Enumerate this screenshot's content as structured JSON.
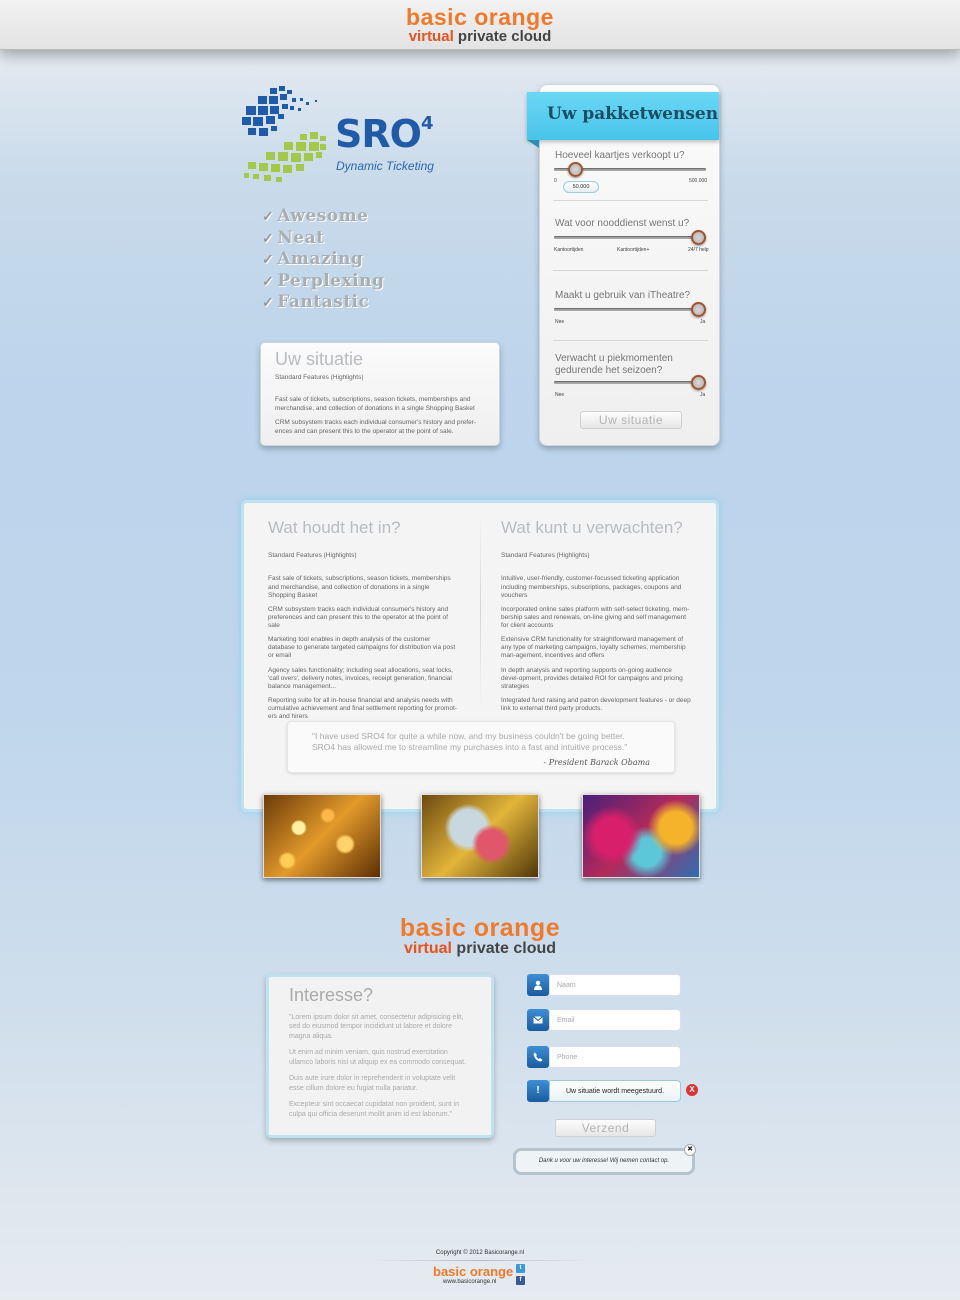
{
  "header": {
    "logo_line1": "basic orange",
    "logo_virtual": "virtual",
    "logo_rest": " private cloud"
  },
  "product": {
    "name": "SRO",
    "superscript": "4",
    "tagline": "Dynamic Ticketing"
  },
  "features": [
    "Awesome",
    "Neat",
    "Amazing",
    "Perplexing",
    "Fantastic"
  ],
  "situation_card": {
    "title": "Uw situatie",
    "subtitle": "Standard Features  (Highlights)",
    "para1": "Fast sale of tickets, subscriptions, season tickets, memberships and merchandise, and collection of donations in a single Shopping Basket",
    "para2": "CRM subsystem tracks each individual consumer's history and prefer-ences and can present this to the operator at the point of sale."
  },
  "package": {
    "title": "Uw pakketwensen",
    "q1": "Hoeveel kaartjes verkoopt u?",
    "q1_min": "0",
    "q1_max": "500.000",
    "q1_value": "50.000",
    "q1_level": 0.1,
    "q2": "Wat voor nooddienst wenst u?",
    "q2_opt1": "Kantoortijden",
    "q2_opt2": "Kantoortijden+",
    "q2_opt3": "24/7 help",
    "q2_level": 1.0,
    "q3": "Maakt u gebruik van iTheatre?",
    "q3_min": "Nee",
    "q3_max": "Ja",
    "q3_level": 1.0,
    "q4": "Verwacht u piekmomenten gedurende het seizoen?",
    "q4_min": "Nee",
    "q4_max": "Ja",
    "q4_level": 1.0,
    "button": "Uw situatie"
  },
  "info": {
    "left_title": "Wat houdt het in?",
    "left_sub": "Standard Features  (Highlights)",
    "left_paras": [
      "Fast sale of tickets, subscriptions, season tickets, memberships and merchandise, and collection of donations in a single Shopping Basket",
      "CRM subsystem tracks each individual consumer's history and preferences and can present this to the operator at the point of sale",
      "Marketing tool enables in depth analysis of the customer database to generate targeted campaigns for distribution via post or email",
      "Agency sales functionality; including seat allocations, seat locks, 'call overs', delivery notes, invoices, receipt generation, financial balance management...",
      "Reporting suite for all in-house financial and analysis needs with cumulative achievement and final settlement reporting for promot-ers and hirers"
    ],
    "right_title": "Wat kunt u verwachten?",
    "right_sub": "Standard Features (Highlights)",
    "right_paras": [
      "Intuitive, user-friendly, customer-focussed ticketing application including memberships, subscriptions, packages, coupons and vouchers",
      "Incorporated online sales platform with self-select ticketing, mem-bership sales and renewals, on-line giving and self management for client accounts",
      "Extensive CRM functionality for straightforward management of any type of marketing campaigns, loyalty schemes, membership man-agement, incentives and offers",
      "In depth analysis and reporting supports on-going audience devel-opment, provides detailed ROI for campaigns and pricing strategies",
      "Integrated fund raising and patron development features - or deep link to external third party products."
    ],
    "quote_line1": "\"I have used SRO4 for quite a while now, and my business couldn't be going better.",
    "quote_line2": "SRO4 has allowed me to streamline my purchases into a fast and intuitive process.\"",
    "quote_author": "- President Barack Obama"
  },
  "interest": {
    "title": "Interesse?",
    "paras": [
      "\"Lorem ipsum dolor sit amet, consectetur adipisicing elit, sed do eiusmod tempor incididunt ut labore et dolore magna aliqua.",
      "Ut enim ad minim veniam, quis nostrud exercitation ullamco laboris nisi ut aliquip ex ea commodo consequat.",
      "Duis aute irure dolor in reprehenderit in voluptate velit esse cillum dolore eu fugiat nulla pariatur.",
      "Excepteur sint occaecat cupidatat non proident, sunt in culpa qui officia deserunt mollit anim id est laborum.\""
    ]
  },
  "form": {
    "name_placeholder": "Naam",
    "email_placeholder": "Email",
    "phone_placeholder": "Phone",
    "status_message": "Uw situatie wordt meegestuurd.",
    "close_glyph": "X",
    "submit": "Verzend",
    "thanks": "Dank u voor uw interesse! Wij nemen contact op.",
    "thanks_close": "✖"
  },
  "footer": {
    "copyright": "Copyright © 2012 Basicorange.nl",
    "logo": "basic orange",
    "url": "www.basicorange.nl",
    "twitter_glyph": "t",
    "facebook_glyph": "f"
  },
  "colors": {
    "orange": "#f07a2c",
    "red_orange": "#e8521e",
    "ribbon": "#55ccee",
    "blue": "#1f5ba8",
    "green": "#a4c94a"
  }
}
